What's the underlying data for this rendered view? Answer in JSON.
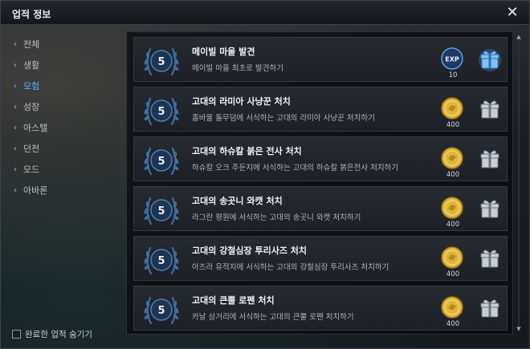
{
  "window": {
    "title": "업적 정보",
    "close_glyph": "✕"
  },
  "sidebar": {
    "items": [
      {
        "label": "전체",
        "active": false
      },
      {
        "label": "생활",
        "active": false
      },
      {
        "label": "모험",
        "active": true
      },
      {
        "label": "성장",
        "active": false
      },
      {
        "label": "아스텔",
        "active": false
      },
      {
        "label": "던전",
        "active": false
      },
      {
        "label": "모드",
        "active": false
      },
      {
        "label": "아바론",
        "active": false
      }
    ],
    "hide_completed_label": "완료한 업적 숨기기",
    "hide_completed_checked": false
  },
  "achievements": [
    {
      "level": "5",
      "title": "메이빌 마을 발견",
      "description": "메이빌 마을 최초로 발견하기",
      "reward_type": "exp",
      "reward_label": "EXP",
      "reward_amount": "10",
      "claim_icon": "gift-box-glow-icon"
    },
    {
      "level": "5",
      "title": "고대의 라미아 사냥꾼 처치",
      "description": "홈바울 돌무덤에 서식하는 고대의 라미아 사냥꾼 처치하기",
      "reward_type": "coin",
      "reward_amount": "400",
      "claim_icon": "gift-box-icon"
    },
    {
      "level": "5",
      "title": "고대의 하슈칼 붉은 전사 처치",
      "description": "하슈칼 오크 주둔지에 서식하는 고대의 하슈칼 붉은전사 처치하기",
      "reward_type": "coin",
      "reward_amount": "400",
      "claim_icon": "gift-box-icon"
    },
    {
      "level": "5",
      "title": "고대의 송곳니 와캣 처치",
      "description": "라그란 평원에 서식하는 고대의 송곳니 와캣 처치하기",
      "reward_type": "coin",
      "reward_amount": "400",
      "claim_icon": "gift-box-icon"
    },
    {
      "level": "5",
      "title": "고대의 강철심장 투리사즈 처치",
      "description": "아즈라 유적지에 서식하는 고대의 강철심장 투리사즈 처치하기",
      "reward_type": "coin",
      "reward_amount": "400",
      "claim_icon": "gift-box-icon"
    },
    {
      "level": "5",
      "title": "고대의 큰뿔 로펜 처치",
      "description": "카날 삼거리에 서식하는 고대의 큰뿔 로펜 처치하기",
      "reward_type": "coin",
      "reward_amount": "400",
      "claim_icon": "gift-box-icon"
    }
  ],
  "colors": {
    "accent_active": "#5ab2ff",
    "medal_blue": "#3f6da3",
    "coin_gold": "#e0b53a"
  }
}
